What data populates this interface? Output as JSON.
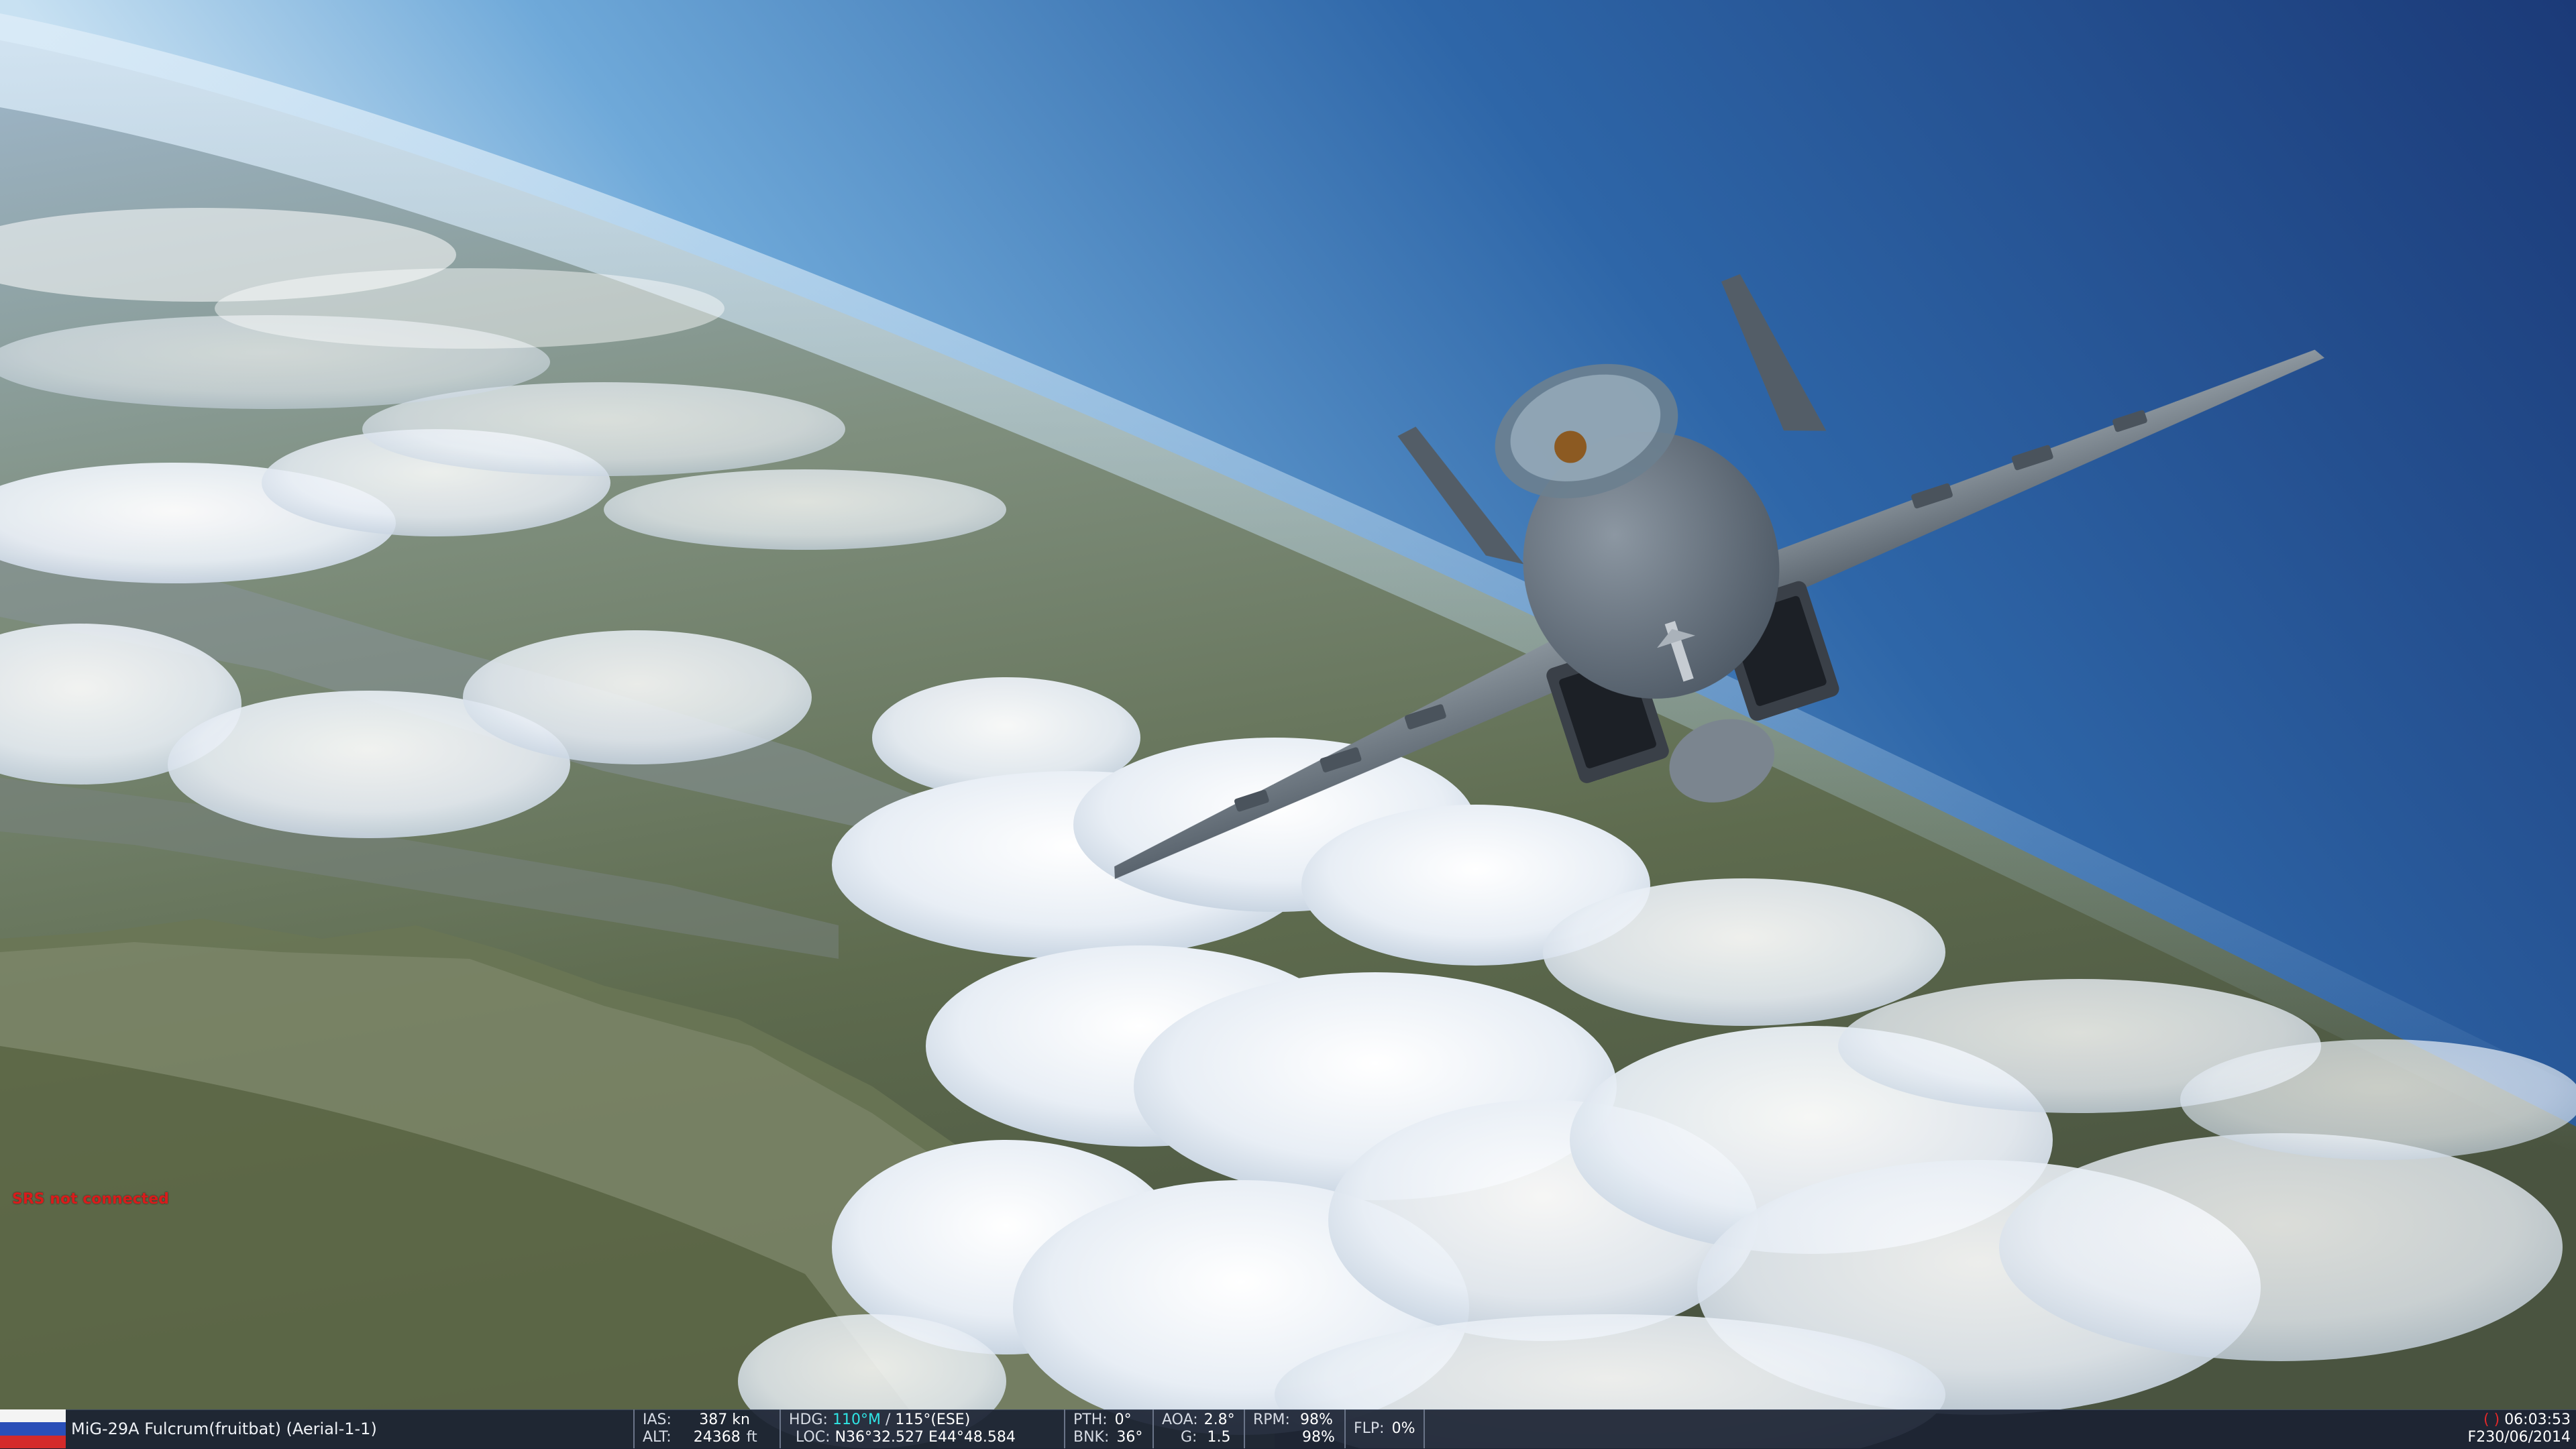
{
  "scene": {
    "description_icons": [
      "aircraft",
      "clouds",
      "mountains",
      "sky"
    ],
    "colors": {
      "sky_top": "#1d3f7c",
      "sky_horizon": "#9cc7ea",
      "cloud": "#eef3f8",
      "terrain": "#6b7a5e",
      "aircraft": "#6e7a86"
    }
  },
  "srs": {
    "status": "SRS not connected",
    "color": "#d81c1c"
  },
  "infobar": {
    "flag_icon": "russia-flag-icon",
    "unit_name": "MiG-29A Fulcrum(fruitbat) (Aerial-1-1)",
    "ias": {
      "label": "IAS:",
      "value": "387 kn"
    },
    "alt": {
      "label": "ALT:",
      "value": "24368",
      "unit": "ft"
    },
    "hdg": {
      "label": "HDG:",
      "value": "110°M",
      "value2": "115°(ESE)"
    },
    "loc": {
      "label": "LOC:",
      "value": "N36°32.527 E44°48.584"
    },
    "pth": {
      "label": "PTH:",
      "value": "0°"
    },
    "bnk": {
      "label": "BNK:",
      "value": "36°"
    },
    "aoa": {
      "label": "AOA:",
      "value": "2.8°"
    },
    "g": {
      "label": "G:",
      "value": "1.5"
    },
    "rpm": {
      "label": "RPM:",
      "value1": "98%",
      "value2": "98%"
    },
    "flp": {
      "label": "FLP:",
      "value": "0%"
    },
    "time_bracket": "( )",
    "time": "06:03:53",
    "date": "F230/06/2014"
  }
}
